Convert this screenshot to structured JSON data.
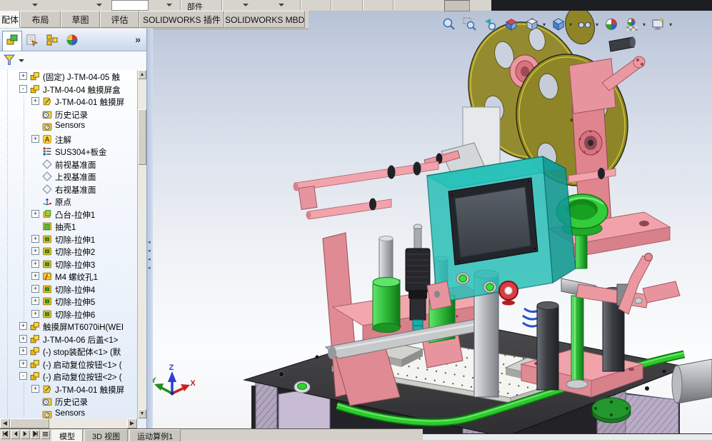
{
  "top_toolbar": {
    "component_button_label": "部件",
    "combo_value": ""
  },
  "command_tabs": {
    "tabs": [
      {
        "label": "配体",
        "active": true,
        "width": 28
      },
      {
        "label": "布局",
        "active": false,
        "width": 57
      },
      {
        "label": "草图",
        "active": false,
        "width": 55
      },
      {
        "label": "评估",
        "active": false,
        "width": 55
      },
      {
        "label": "SOLIDWORKS 插件",
        "active": false,
        "width": 119
      },
      {
        "label": "SOLIDWORKS MBD",
        "active": false,
        "width": 113
      }
    ]
  },
  "headsup_toolbar": {
    "icons": [
      {
        "name": "zoom-fit-icon",
        "dropdown": false
      },
      {
        "name": "zoom-area-icon",
        "dropdown": false
      },
      {
        "name": "previous-view-icon",
        "dropdown": false
      },
      {
        "name": "section-view-icon",
        "dropdown": false
      },
      {
        "name": "view-orientation-icon",
        "dropdown": true
      },
      {
        "name": "display-style-icon",
        "dropdown": true
      },
      {
        "name": "hide-show-items-icon",
        "dropdown": true
      },
      {
        "name": "edit-appearance-icon",
        "dropdown": false
      },
      {
        "name": "apply-scene-icon",
        "dropdown": true
      },
      {
        "name": "view-settings-icon",
        "dropdown": true
      }
    ]
  },
  "feature_panel": {
    "tabs": [
      {
        "name": "featuremanager-tree-tab",
        "icon": "featuremanager-icon",
        "active": true
      },
      {
        "name": "propertymanager-tab",
        "icon": "propertymanager-icon",
        "active": false
      },
      {
        "name": "configurationmanager-tab",
        "icon": "configurationmanager-icon",
        "active": false
      },
      {
        "name": "displaymanager-tab",
        "icon": "displaymanager-icon",
        "active": false
      }
    ],
    "overflow_chevron": "»",
    "filter_icon": "filter-funnel-icon",
    "tree_items": [
      {
        "indent": 1,
        "expand": "plus",
        "icon": "assembly-icon",
        "label": "(固定) J-TM-04-05 触"
      },
      {
        "indent": 1,
        "expand": "minus",
        "icon": "assembly-icon",
        "label": "J-TM-04-04 触摸屏盒"
      },
      {
        "indent": 2,
        "expand": "plus",
        "icon": "part-icon",
        "label": "J-TM-04-01 触摸屏"
      },
      {
        "indent": 2,
        "expand": "none",
        "icon": "history-icon",
        "label": "历史记录"
      },
      {
        "indent": 2,
        "expand": "none",
        "icon": "sensors-icon",
        "label": "Sensors"
      },
      {
        "indent": 2,
        "expand": "plus",
        "icon": "annotations-icon",
        "label": "注解"
      },
      {
        "indent": 2,
        "expand": "none",
        "icon": "material-icon",
        "label": "SUS304+板金"
      },
      {
        "indent": 2,
        "expand": "none",
        "icon": "plane-icon",
        "label": "前视基准面"
      },
      {
        "indent": 2,
        "expand": "none",
        "icon": "plane-icon",
        "label": "上视基准面"
      },
      {
        "indent": 2,
        "expand": "none",
        "icon": "plane-icon",
        "label": "右视基准面"
      },
      {
        "indent": 2,
        "expand": "none",
        "icon": "origin-icon",
        "label": "原点"
      },
      {
        "indent": 2,
        "expand": "plus",
        "icon": "boss-extrude-icon",
        "label": "凸台-拉伸1"
      },
      {
        "indent": 2,
        "expand": "none",
        "icon": "shell-icon",
        "label": "抽壳1"
      },
      {
        "indent": 2,
        "expand": "plus",
        "icon": "cut-extrude-icon",
        "label": "切除-拉伸1"
      },
      {
        "indent": 2,
        "expand": "plus",
        "icon": "cut-extrude-icon",
        "label": "切除-拉伸2"
      },
      {
        "indent": 2,
        "expand": "plus",
        "icon": "cut-extrude-icon",
        "label": "切除-拉伸3"
      },
      {
        "indent": 2,
        "expand": "plus",
        "icon": "hole-wizard-icon",
        "label": "M4 螺纹孔1"
      },
      {
        "indent": 2,
        "expand": "plus",
        "icon": "cut-extrude-icon",
        "label": "切除-拉伸4"
      },
      {
        "indent": 2,
        "expand": "plus",
        "icon": "cut-extrude-icon",
        "label": "切除-拉伸5"
      },
      {
        "indent": 2,
        "expand": "plus",
        "icon": "cut-extrude-icon",
        "label": "切除-拉伸6"
      },
      {
        "indent": 1,
        "expand": "plus",
        "icon": "assembly-icon",
        "label": "触摸屏MT6070iH(WEI"
      },
      {
        "indent": 1,
        "expand": "plus",
        "icon": "assembly-icon",
        "label": "J-TM-04-06 后盖<1>"
      },
      {
        "indent": 1,
        "expand": "plus",
        "icon": "assembly-icon",
        "label": "(-) stop装配体<1> (默"
      },
      {
        "indent": 1,
        "expand": "plus",
        "icon": "assembly-icon",
        "label": "(-) 启动复位按钮<1> ("
      },
      {
        "indent": 1,
        "expand": "minus",
        "icon": "assembly-icon",
        "label": "(-) 启动复位按钮<2> ("
      },
      {
        "indent": 2,
        "expand": "plus",
        "icon": "part-icon",
        "label": "J-TM-04-01 触摸屏"
      },
      {
        "indent": 2,
        "expand": "none",
        "icon": "history-icon",
        "label": "历史记录"
      },
      {
        "indent": 2,
        "expand": "none",
        "icon": "sensors-icon",
        "label": "Sensors"
      }
    ]
  },
  "motion_bar": {
    "nav_icons": [
      "skip-start-icon",
      "step-back-icon",
      "step-forward-icon",
      "skip-end-icon",
      "motion-menu-icon"
    ],
    "tabs": [
      {
        "label": "模型",
        "active": true
      },
      {
        "label": "3D 视图",
        "active": false
      },
      {
        "label": "运动算例1",
        "active": false
      }
    ]
  },
  "viewport": {
    "triad": {
      "x_label": "X",
      "y_label": "Y",
      "z_label": "Z",
      "x_color": "#CC1F1F",
      "y_color": "#1C8F1C",
      "z_color": "#2B3FD6"
    },
    "background_top": "#B7C2D6",
    "background_bottom": "#F2F3F5",
    "model_colors": {
      "frame_pink": "#F2A2AA",
      "reel_olive": "#8F8628",
      "hmi_teal": "#1FBDB5",
      "accent_green": "#2BCB2B",
      "table_dark": "#3F3F41",
      "extrusion_purple": "#A89BB4",
      "steel_gray": "#9DA2A8"
    }
  }
}
